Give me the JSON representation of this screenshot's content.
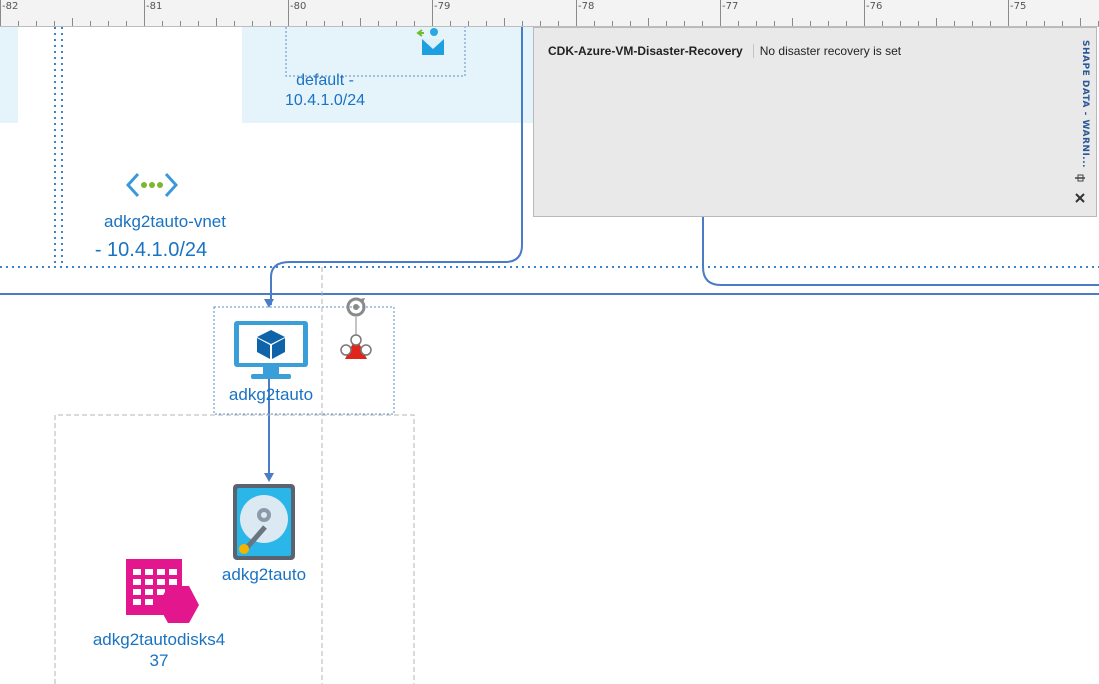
{
  "ruler": {
    "ticks": [
      "-82",
      "-81",
      "-80",
      "-79",
      "-78",
      "-77",
      "-76",
      "-75"
    ]
  },
  "diagram": {
    "subnet_label_line1": "default -",
    "subnet_label_line2": "10.4.1.0/24",
    "vnet_label_line1": "adkg2tauto-vnet",
    "vnet_label_line2": "- 10.4.1.0/24",
    "vm_label": "adkg2tauto",
    "disk_label": "adkg2tauto",
    "storage_label_line1": "adkg2tautodisks4",
    "storage_label_line2": "37"
  },
  "shape_data_panel": {
    "title": "SHAPE DATA - WARNI...",
    "property_name": "CDK-Azure-VM-Disaster-Recovery",
    "property_value": "No disaster recovery is set",
    "pin_icon": "pin-icon",
    "close_icon": "close-icon"
  },
  "colors": {
    "connector": "#4a7cc7",
    "label": "#1a73c2",
    "region": "#e5f3fb",
    "panel_bg": "#e9e9e9"
  }
}
